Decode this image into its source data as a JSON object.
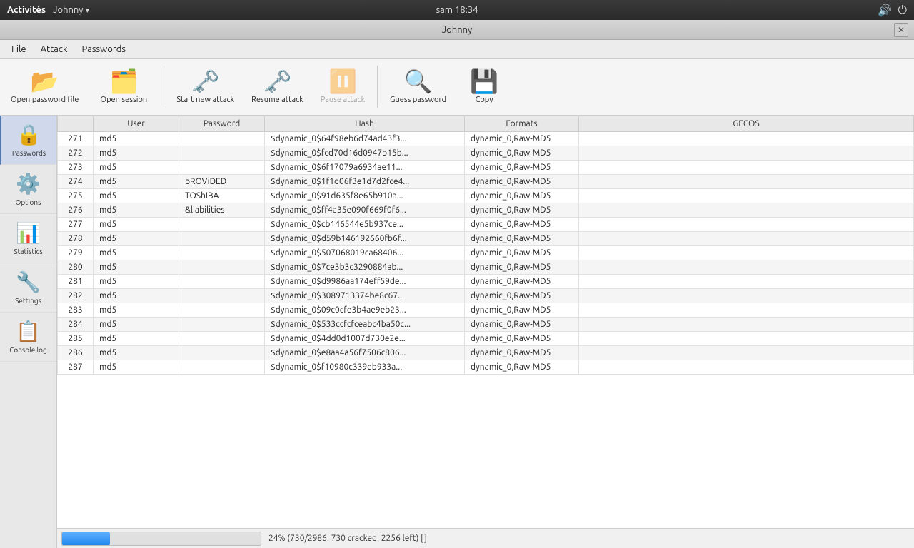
{
  "topbar": {
    "app_name": "Activités",
    "window_name": "Johnny",
    "window_arrow": "▾",
    "time": "sam 18:34",
    "icon_volume": "🔊",
    "icon_power": "⏻"
  },
  "titlebar": {
    "title": "Johnny",
    "close_label": "✕"
  },
  "menu": {
    "items": [
      "File",
      "Attack",
      "Passwords"
    ]
  },
  "toolbar": {
    "buttons": [
      {
        "id": "open-password-file",
        "label": "Open password file",
        "icon": "📂",
        "disabled": false
      },
      {
        "id": "open-session",
        "label": "Open session",
        "icon": "🗂️",
        "disabled": false
      },
      {
        "id": "start-new-attack",
        "label": "Start new attack",
        "icon": "🔑",
        "disabled": false
      },
      {
        "id": "resume-attack",
        "label": "Resume attack",
        "icon": "🔑",
        "disabled": false
      },
      {
        "id": "pause-attack",
        "label": "Pause attack",
        "icon": "⏸",
        "disabled": true
      },
      {
        "id": "guess-password",
        "label": "Guess password",
        "icon": "🔍",
        "disabled": false
      },
      {
        "id": "copy",
        "label": "Copy",
        "icon": "💾",
        "disabled": false
      }
    ]
  },
  "sidebar": {
    "items": [
      {
        "id": "passwords",
        "label": "Passwords",
        "icon": "🔒",
        "active": true
      },
      {
        "id": "options",
        "label": "Options",
        "icon": "⚙️",
        "active": false
      },
      {
        "id": "statistics",
        "label": "Statistics",
        "icon": "📊",
        "active": false
      },
      {
        "id": "settings",
        "label": "Settings",
        "icon": "🔧",
        "active": false
      },
      {
        "id": "console-log",
        "label": "Console log",
        "icon": "📋",
        "active": false
      }
    ]
  },
  "table": {
    "columns": [
      "",
      "User",
      "Password",
      "Hash",
      "Formats",
      "GECOS"
    ],
    "rows": [
      {
        "num": "271",
        "user": "md5",
        "password": "",
        "hash": "$dynamic_0$64f98eb6d74ad43f3...",
        "formats": "dynamic_0,Raw-MD5",
        "gecos": ""
      },
      {
        "num": "272",
        "user": "md5",
        "password": "",
        "hash": "$dynamic_0$fcd70d16d0947b15b...",
        "formats": "dynamic_0,Raw-MD5",
        "gecos": ""
      },
      {
        "num": "273",
        "user": "md5",
        "password": "",
        "hash": "$dynamic_0$6f17079a6934ae11...",
        "formats": "dynamic_0,Raw-MD5",
        "gecos": ""
      },
      {
        "num": "274",
        "user": "md5",
        "password": "pROViDED",
        "hash": "$dynamic_0$1f1d06f3e1d7d2fce4...",
        "formats": "dynamic_0,Raw-MD5",
        "gecos": ""
      },
      {
        "num": "275",
        "user": "md5",
        "password": "TOShIBA",
        "hash": "$dynamic_0$91d635f8e65b910a...",
        "formats": "dynamic_0,Raw-MD5",
        "gecos": ""
      },
      {
        "num": "276",
        "user": "md5",
        "password": "&liabilities",
        "hash": "$dynamic_0$ff4a35e090f669f0f6...",
        "formats": "dynamic_0,Raw-MD5",
        "gecos": ""
      },
      {
        "num": "277",
        "user": "md5",
        "password": "",
        "hash": "$dynamic_0$cb146544e5b937ce...",
        "formats": "dynamic_0,Raw-MD5",
        "gecos": ""
      },
      {
        "num": "278",
        "user": "md5",
        "password": "",
        "hash": "$dynamic_0$d59b146192660fb6f...",
        "formats": "dynamic_0,Raw-MD5",
        "gecos": ""
      },
      {
        "num": "279",
        "user": "md5",
        "password": "",
        "hash": "$dynamic_0$507068019ca68406...",
        "formats": "dynamic_0,Raw-MD5",
        "gecos": ""
      },
      {
        "num": "280",
        "user": "md5",
        "password": "",
        "hash": "$dynamic_0$7ce3b3c3290884ab...",
        "formats": "dynamic_0,Raw-MD5",
        "gecos": ""
      },
      {
        "num": "281",
        "user": "md5",
        "password": "",
        "hash": "$dynamic_0$d9986aa174eff59de...",
        "formats": "dynamic_0,Raw-MD5",
        "gecos": ""
      },
      {
        "num": "282",
        "user": "md5",
        "password": "",
        "hash": "$dynamic_0$3089713374be8c67...",
        "formats": "dynamic_0,Raw-MD5",
        "gecos": ""
      },
      {
        "num": "283",
        "user": "md5",
        "password": "",
        "hash": "$dynamic_0$09c0cfe3b4ae9eb23...",
        "formats": "dynamic_0,Raw-MD5",
        "gecos": ""
      },
      {
        "num": "284",
        "user": "md5",
        "password": "",
        "hash": "$dynamic_0$533ccfcfceabc4ba50c...",
        "formats": "dynamic_0,Raw-MD5",
        "gecos": ""
      },
      {
        "num": "285",
        "user": "md5",
        "password": "",
        "hash": "$dynamic_0$4dd0d1007d730e2e...",
        "formats": "dynamic_0,Raw-MD5",
        "gecos": ""
      },
      {
        "num": "286",
        "user": "md5",
        "password": "",
        "hash": "$dynamic_0$e8aa4a56f7506c806...",
        "formats": "dynamic_0,Raw-MD5",
        "gecos": ""
      },
      {
        "num": "287",
        "user": "md5",
        "password": "",
        "hash": "$dynamic_0$f10980c339eb933a...",
        "formats": "dynamic_0,Raw-MD5",
        "gecos": ""
      }
    ]
  },
  "statusbar": {
    "progress_percent": 24,
    "progress_width_percent": 24,
    "status_text": "24% (730/2986: 730 cracked, 2256 left) []"
  }
}
